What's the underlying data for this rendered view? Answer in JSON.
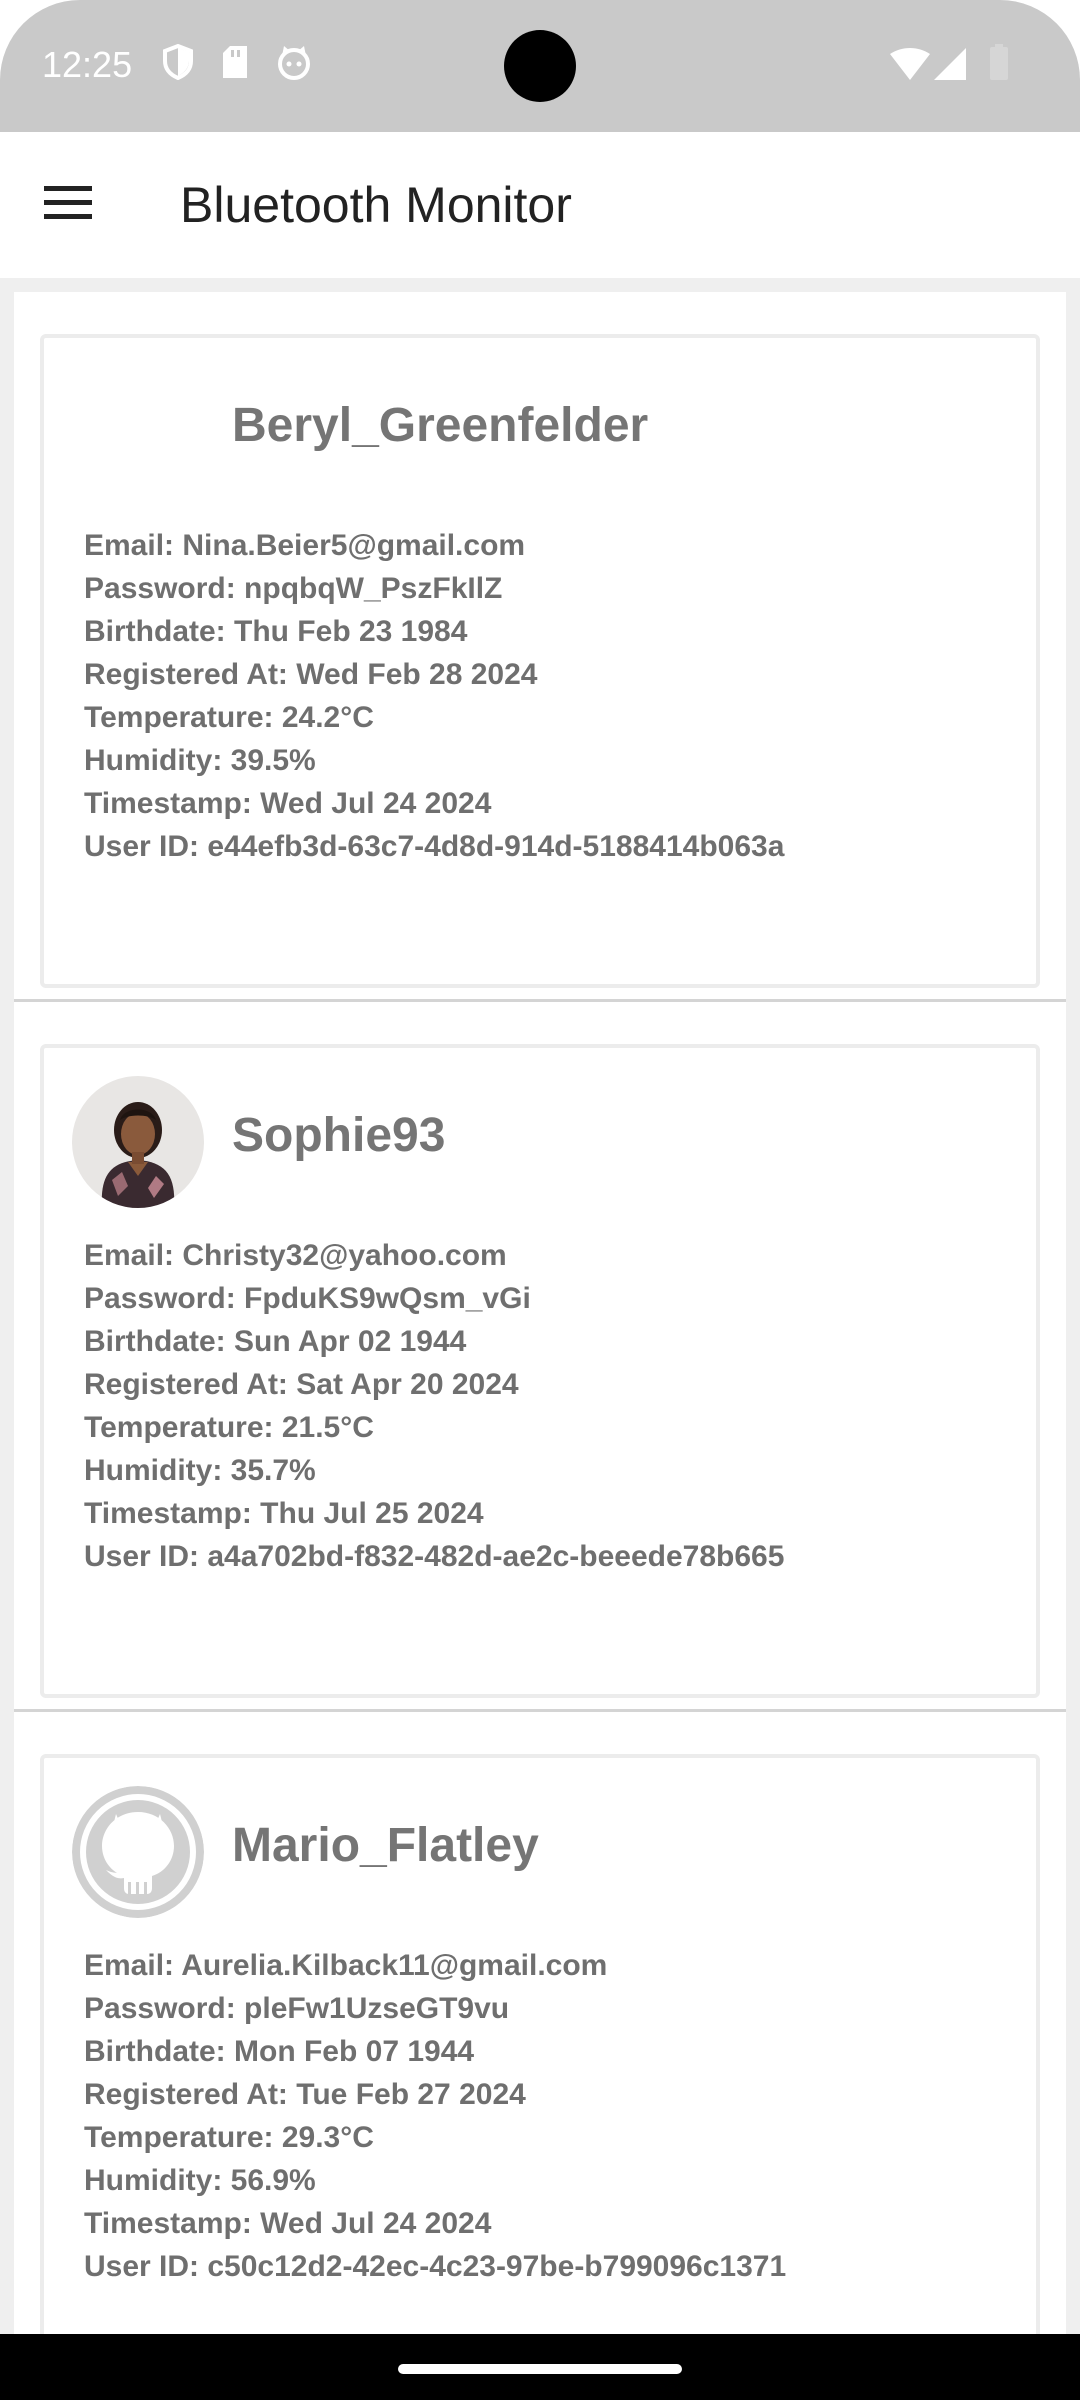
{
  "status_bar": {
    "time": "12:25",
    "icons_left": [
      "shield-icon",
      "sd-card-icon",
      "cat-face-icon"
    ],
    "icons_right": [
      "wifi-icon",
      "cellular-signal-icon",
      "battery-icon"
    ]
  },
  "app_bar": {
    "menu_icon": "hamburger-menu-icon",
    "title": "Bluetooth Monitor"
  },
  "users": [
    {
      "username": "Beryl_Greenfelder",
      "avatar": "none",
      "email": "Email: Nina.Beier5@gmail.com",
      "password": "Password: npqbqW_PszFkIlZ",
      "birthdate": "Birthdate: Thu Feb 23 1984",
      "registered_at": "Registered At: Wed Feb 28 2024",
      "temperature": "Temperature: 24.2°C",
      "humidity": "Humidity: 39.5%",
      "timestamp": "Timestamp: Wed Jul 24 2024",
      "user_id": "User ID: e44efb3d-63c7-4d8d-914d-5188414b063a"
    },
    {
      "username": "Sophie93",
      "avatar": "person-photo",
      "email": "Email: Christy32@yahoo.com",
      "password": "Password: FpduKS9wQsm_vGi",
      "birthdate": "Birthdate: Sun Apr 02 1944",
      "registered_at": "Registered At: Sat Apr 20 2024",
      "temperature": "Temperature: 21.5°C",
      "humidity": "Humidity: 35.7%",
      "timestamp": "Timestamp: Thu Jul 25 2024",
      "user_id": "User ID: a4a702bd-f832-482d-ae2c-beeede78b665"
    },
    {
      "username": "Mario_Flatley",
      "avatar": "github-icon",
      "email": "Email: Aurelia.Kilback11@gmail.com",
      "password": "Password: pleFw1UzseGT9vu",
      "birthdate": "Birthdate: Mon Feb 07 1944",
      "registered_at": "Registered At: Tue Feb 27 2024",
      "temperature": "Temperature: 29.3°C",
      "humidity": "Humidity: 56.9%",
      "timestamp": "Timestamp: Wed Jul 24 2024",
      "user_id": "User ID: c50c12d2-42ec-4c23-97be-b799096c1371"
    }
  ],
  "colors": {
    "status_bar_bg": "#c9c9c9",
    "text_primary": "#222222",
    "card_text": "#6f6f6f",
    "list_bg": "#efefef"
  }
}
